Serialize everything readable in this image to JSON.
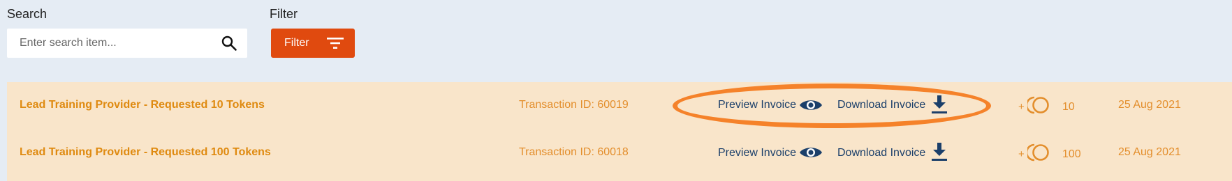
{
  "search": {
    "label": "Search",
    "placeholder": "Enter search item...",
    "value": ""
  },
  "filter": {
    "label": "Filter",
    "button_label": "Filter"
  },
  "transactions": [
    {
      "title": "Lead Training Provider - Requested 10 Tokens",
      "transaction_id": "Transaction ID: 60019",
      "preview_label": "Preview Invoice",
      "download_label": "Download Invoice",
      "plus": "+",
      "tokens": "10",
      "date": "25 Aug 2021"
    },
    {
      "title": "Lead Training Provider - Requested 100 Tokens",
      "transaction_id": "Transaction ID: 60018",
      "preview_label": "Preview Invoice",
      "download_label": "Download Invoice",
      "plus": "+",
      "tokens": "100",
      "date": "25 Aug 2021"
    }
  ],
  "icons": {
    "search": "search-icon",
    "filter": "filter-icon",
    "preview": "eye-icon",
    "download": "download-icon",
    "tokens": "token-coin-icon"
  },
  "colors": {
    "background": "#e5ecf4",
    "filter_button": "#e04a0f",
    "row_background": "#f9e5ca",
    "accent_orange": "#e38e2c",
    "title_orange": "#df8a10",
    "link_blue": "#1b3f6a",
    "highlight": "#f5822a"
  }
}
